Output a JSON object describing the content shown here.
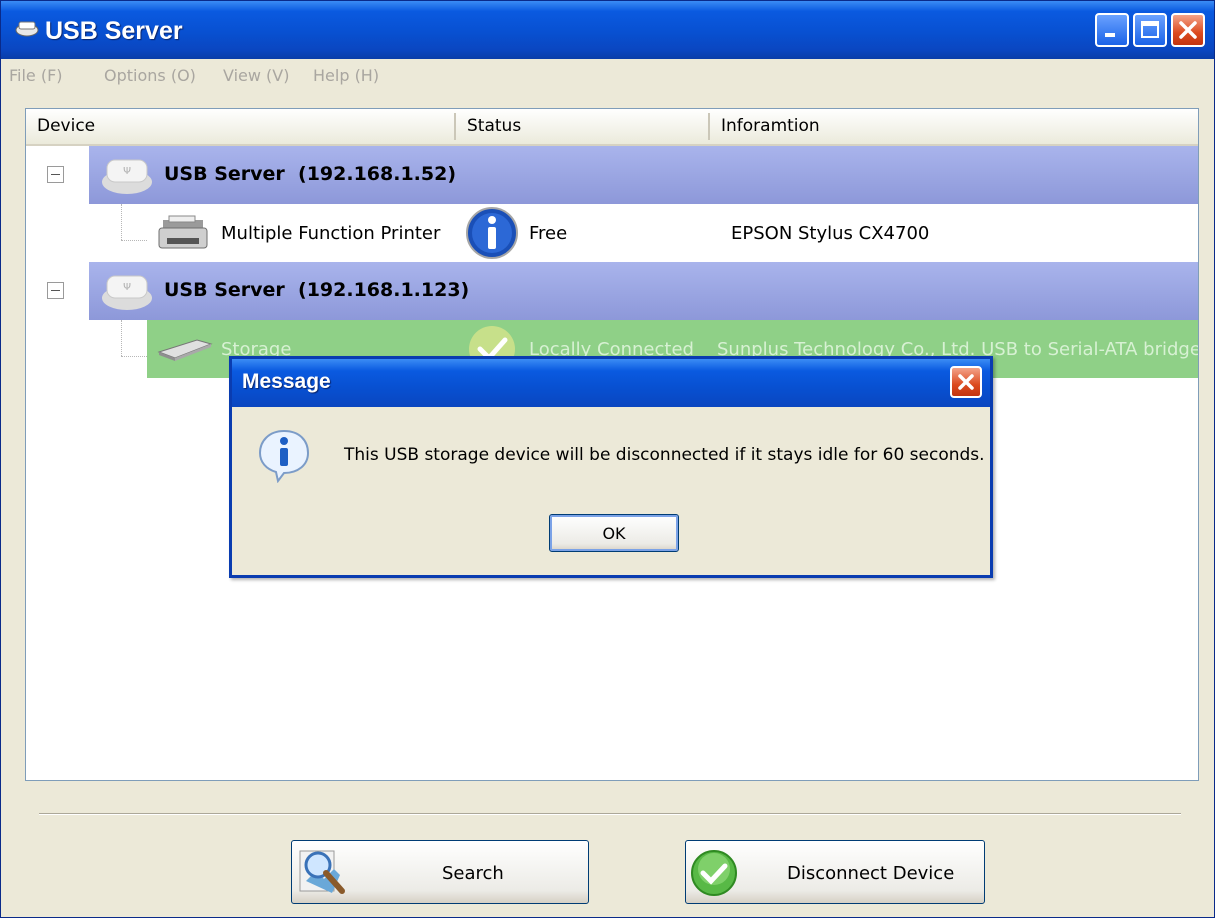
{
  "window": {
    "title": "USB Server",
    "menu": [
      "File (F)",
      "Options (O)",
      "View (V)",
      "Help (H)"
    ]
  },
  "list": {
    "columns": [
      "Device",
      "Status",
      "Inforamtion"
    ],
    "groups": [
      {
        "label": "USB Server  (192.168.1.52)",
        "device": {
          "name": "Multiple Function Printer",
          "status": "Free",
          "info": "EPSON Stylus CX4700",
          "status_icon": "info-icon",
          "device_icon": "printer-icon"
        }
      },
      {
        "label": "USB Server  (192.168.1.123)",
        "device": {
          "name": "Storage",
          "status": "Locally Connected",
          "info": "Sunplus Technology Co., Ltd. USB to Serial-ATA bridge",
          "status_icon": "check-icon",
          "device_icon": "storage-drive-icon"
        }
      }
    ]
  },
  "buttons": {
    "search": "Search",
    "disconnect": "Disconnect Device"
  },
  "dialog": {
    "title": "Message",
    "message": "This USB storage device will be disconnected if it stays idle for 60 seconds.",
    "ok": "OK"
  },
  "colors": {
    "group_row": "#97a2e0",
    "selected_row": "#8fd087",
    "titlebar": "#0a5ae0"
  }
}
